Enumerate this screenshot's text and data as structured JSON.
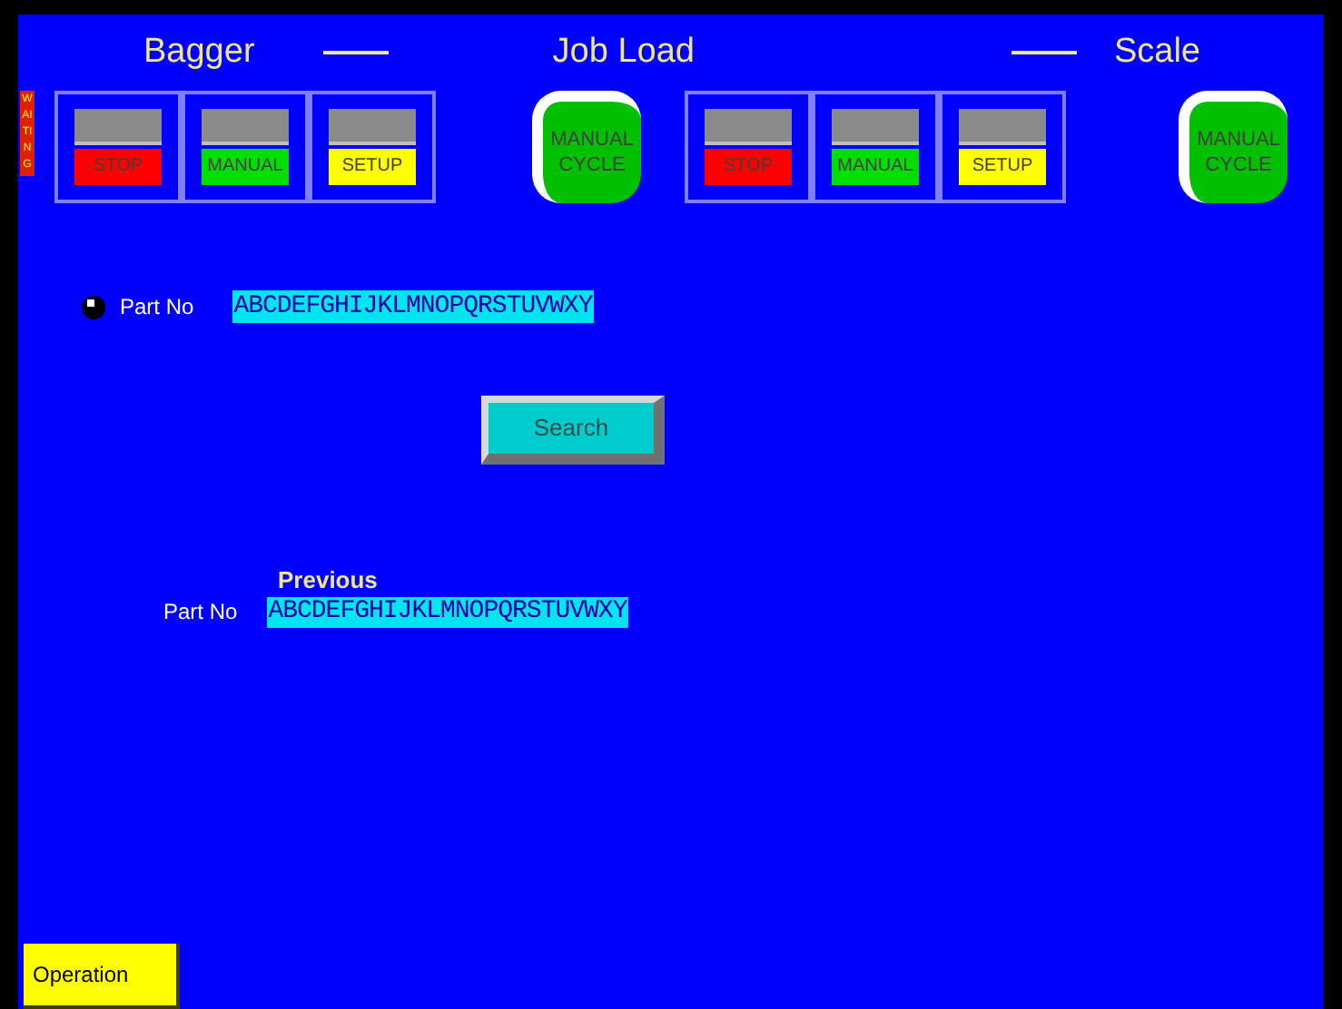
{
  "header": {
    "titles": [
      "Bagger",
      "Job Load",
      "Scale"
    ]
  },
  "status_strip": {
    "label": "WAITING"
  },
  "groups": [
    {
      "modules": [
        {
          "label": "STOP",
          "color": "#ff0000"
        },
        {
          "label": "MANUAL",
          "color": "#00e000"
        },
        {
          "label": "SETUP",
          "color": "#ffff00"
        }
      ],
      "cycle_button": {
        "line1": "MANUAL",
        "line2": "CYCLE"
      }
    },
    {
      "modules": [
        {
          "label": "STOP",
          "color": "#ff0000"
        },
        {
          "label": "MANUAL",
          "color": "#00e000"
        },
        {
          "label": "SETUP",
          "color": "#ffff00"
        }
      ],
      "cycle_button": {
        "line1": "MANUAL",
        "line2": "CYCLE"
      }
    }
  ],
  "search": {
    "label": "Part No",
    "value": "ABCDEFGHIJKLMNOPQRSTUVWXY",
    "button": "Search"
  },
  "previous": {
    "heading": "Previous",
    "label": "Part No",
    "value": "ABCDEFGHIJKLMNOPQRSTUVWXY"
  },
  "footer": {
    "button": "Operation"
  }
}
